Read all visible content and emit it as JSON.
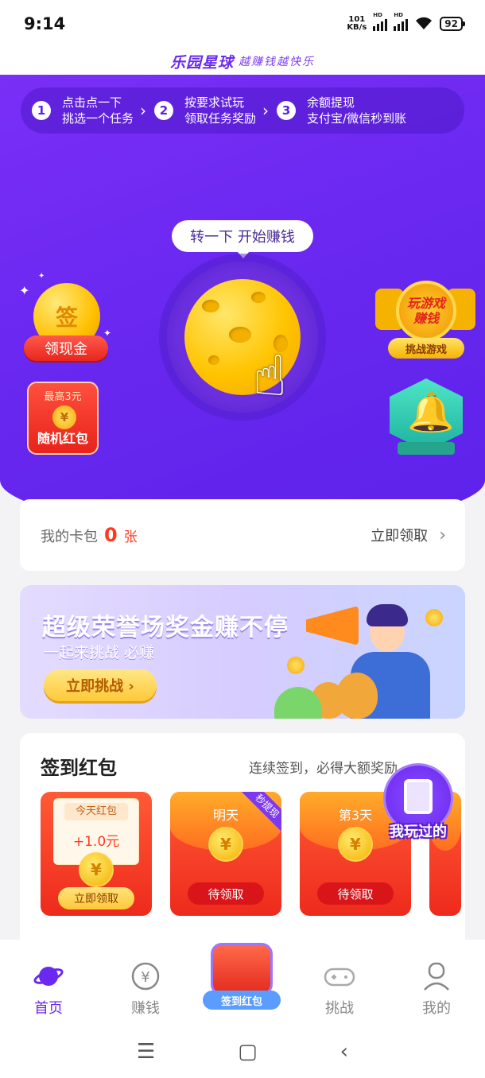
{
  "status": {
    "time": "9:14",
    "net_speed": "101",
    "net_unit": "KB/s",
    "hd1": "HD",
    "hd2": "HD",
    "battery": "92"
  },
  "brand": {
    "logo": "乐园星球",
    "slogan": "越赚钱越快乐"
  },
  "steps": [
    {
      "num": "1",
      "line1": "点击点一下",
      "line2": "挑选一个任务"
    },
    {
      "num": "2",
      "line1": "按要求试玩",
      "line2": "领取任务奖励"
    },
    {
      "num": "3",
      "line1": "余额提现",
      "line2": "支付宝/微信秒到账"
    }
  ],
  "hero": {
    "spin_bubble": "转一下 开始赚钱",
    "sign_coin": "签",
    "sign_label": "领现金",
    "red_packet_top": "最高3元",
    "red_packet_coin": "¥",
    "red_packet_label": "随机红包",
    "game_badge_text": "玩游戏 赚钱",
    "game_badge_label": "挑战游戏"
  },
  "wallet": {
    "label": "我的卡包",
    "count": "0",
    "unit": "张",
    "action": "立即领取"
  },
  "banner": {
    "title": "超级荣誉场奖金赚不停",
    "subtitle": "一起来挑战 必赚",
    "button": "立即挑战 ›"
  },
  "signin": {
    "title": "签到红包",
    "hint": "连续签到，必得大额奖励",
    "packets": [
      {
        "day": "今天红包",
        "amount": "+1.0元",
        "coin": "¥",
        "button": "立即领取"
      },
      {
        "day": "明天",
        "coin": "¥",
        "button": "待领取",
        "tag": "秒提现"
      },
      {
        "day": "第3天",
        "coin": "¥",
        "button": "待领取"
      }
    ]
  },
  "played": {
    "label": "我玩过的"
  },
  "nav": {
    "items": [
      {
        "label": "首页",
        "icon": "planet-icon"
      },
      {
        "label": "赚钱",
        "icon": "yen-icon"
      },
      {
        "label": "签到红包",
        "icon": "red-packet-icon"
      },
      {
        "label": "挑战",
        "icon": "gamepad-icon"
      },
      {
        "label": "我的",
        "icon": "profile-icon"
      }
    ],
    "active": "首页"
  },
  "colors": {
    "brand_purple": "#6a28f0",
    "accent_red": "#ff3b1f",
    "gold": "#ffc400"
  }
}
